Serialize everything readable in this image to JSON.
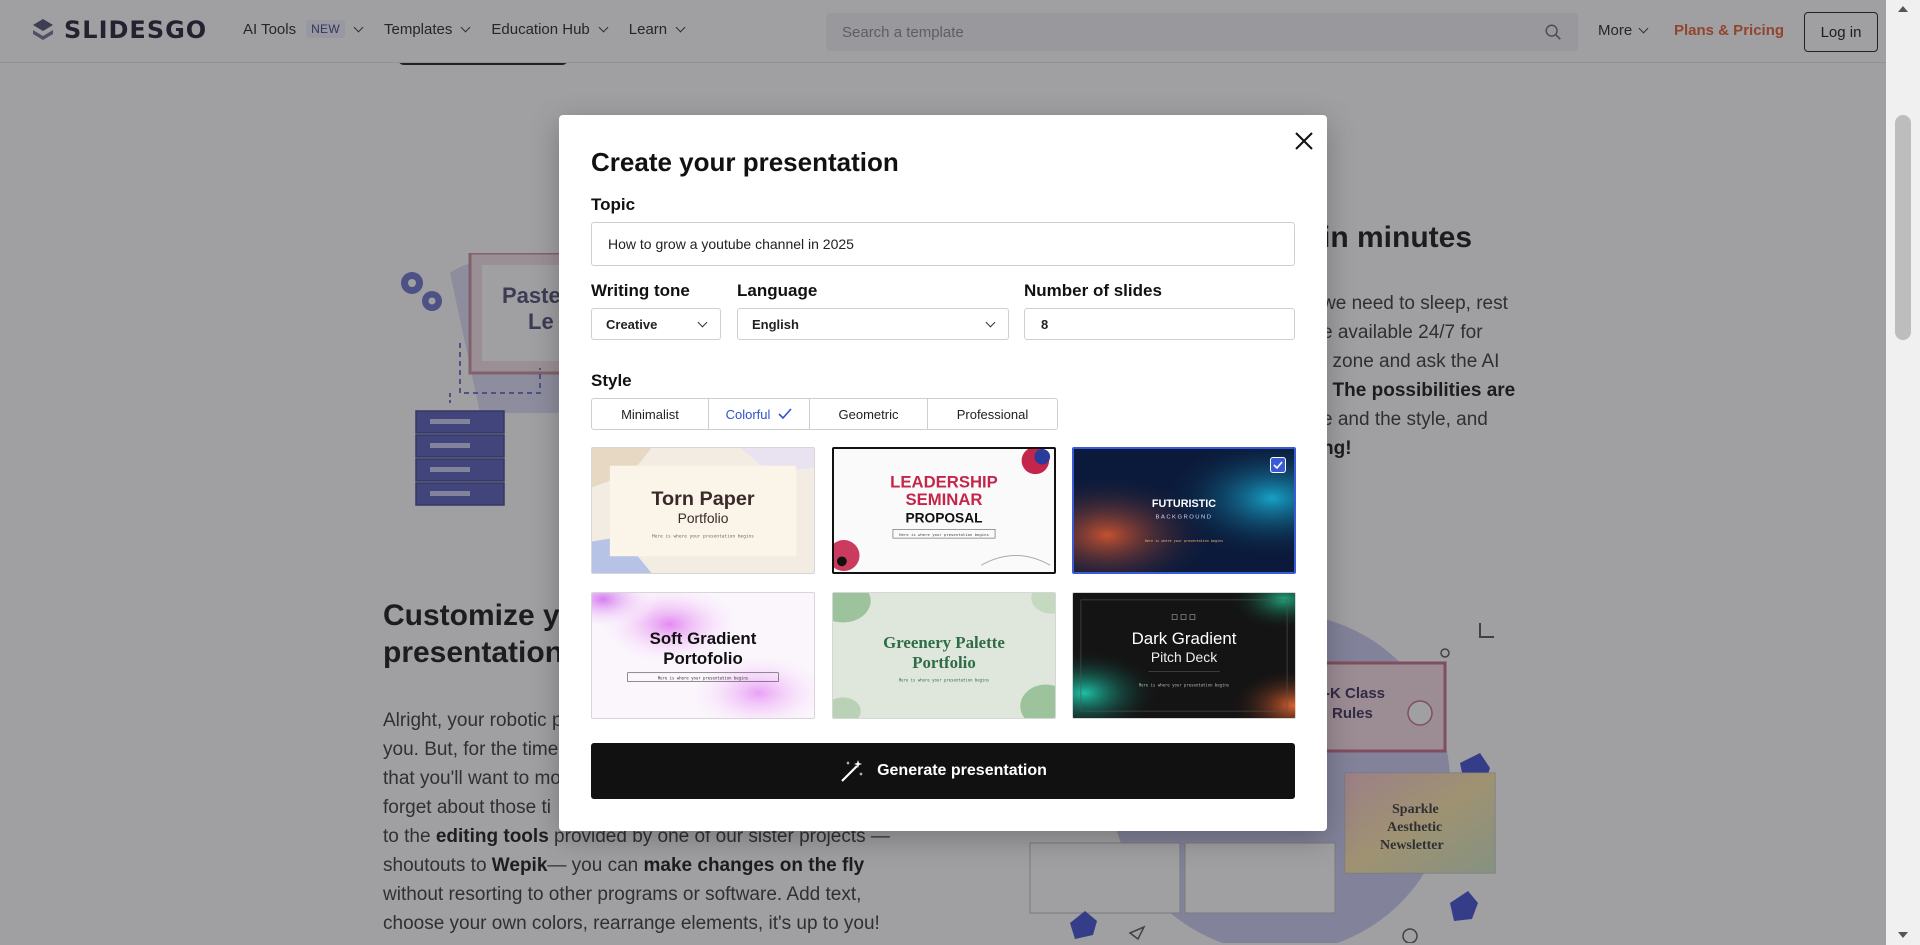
{
  "header": {
    "logo_text": "SLIDESGO",
    "nav": [
      {
        "label": "AI Tools",
        "badge": "NEW"
      },
      {
        "label": "Templates"
      },
      {
        "label": "Education Hub"
      },
      {
        "label": "Learn"
      }
    ],
    "search_placeholder": "Search a template",
    "more_label": "More",
    "pricing_label": "Plans & Pricing",
    "login_label": "Log in",
    "pricing_color": "#e35a28"
  },
  "background": {
    "section1": {
      "heading_visible": "in minutes",
      "paragraph_lines": [
        "we need to sleep, rest",
        "e available 24/7 for",
        "t zone and ask the AI",
        ". The possibilities are",
        "e and the style, and",
        "ng!"
      ]
    },
    "section2": {
      "heading_lines": [
        "Customize yo",
        "presentation"
      ],
      "paragraph": {
        "line1": "Alright, your robotic p",
        "line2": "you. But, for the time",
        "line3": "that you'll want to mo",
        "line4": "forget about those ti",
        "line5_pre": "to the ",
        "line5_bold": "editing tools",
        "line5_post": " provided by one of our sister projects —",
        "line6_pre": "shoutouts to ",
        "line6_bold": "Wepik",
        "line6_mid": "— you can ",
        "line6_bold2": "make changes on the fly",
        "line7": "without resorting to other programs or software. Add text,",
        "line8": "choose your own colors, rearrange elements, it's up to you!"
      }
    },
    "illustrations": {
      "left_card_text": "Paste",
      "left_card_text2": "Le",
      "right_card1_text": "-K Class",
      "right_card1_text2": "Rules",
      "right_card2_text": "Sparkle",
      "right_card2_text2": "Aesthetic",
      "right_card2_text3": "Newsletter"
    }
  },
  "modal": {
    "title": "Create your presentation",
    "topic_label": "Topic",
    "topic_value": "How to grow a youtube channel in 2025",
    "tone_label": "Writing tone",
    "tone_value": "Creative",
    "language_label": "Language",
    "language_value": "English",
    "slides_label": "Number of slides",
    "slides_value": "8",
    "style_label": "Style",
    "styles": [
      "Minimalist",
      "Colorful",
      "Geometric",
      "Professional"
    ],
    "selected_style": "Colorful",
    "templates": [
      {
        "title": "Torn Paper",
        "subtitle": "Portfolio",
        "caption": "Here is where your presentation begins"
      },
      {
        "title": "LEADERSHIP",
        "title2": "SEMINAR",
        "subtitle": "PROPOSAL",
        "caption": "Here is where your presentation begins"
      },
      {
        "title": "FUTURISTIC",
        "subtitle": "BACKGROUND",
        "caption": "Here is where your presentation begins"
      },
      {
        "title": "Soft Gradient",
        "title2": "Portofolio",
        "caption": "Here is where your presentation begins"
      },
      {
        "title": "Greenery Palette",
        "title2": "Portfolio",
        "caption": "Here is where your presentation begins"
      },
      {
        "title": "Dark Gradient",
        "subtitle": "Pitch Deck",
        "caption": "Here is where your presentation begins"
      }
    ],
    "selected_template_index": 2,
    "generate_label": "Generate presentation",
    "accent_color": "#3b5bd6"
  }
}
